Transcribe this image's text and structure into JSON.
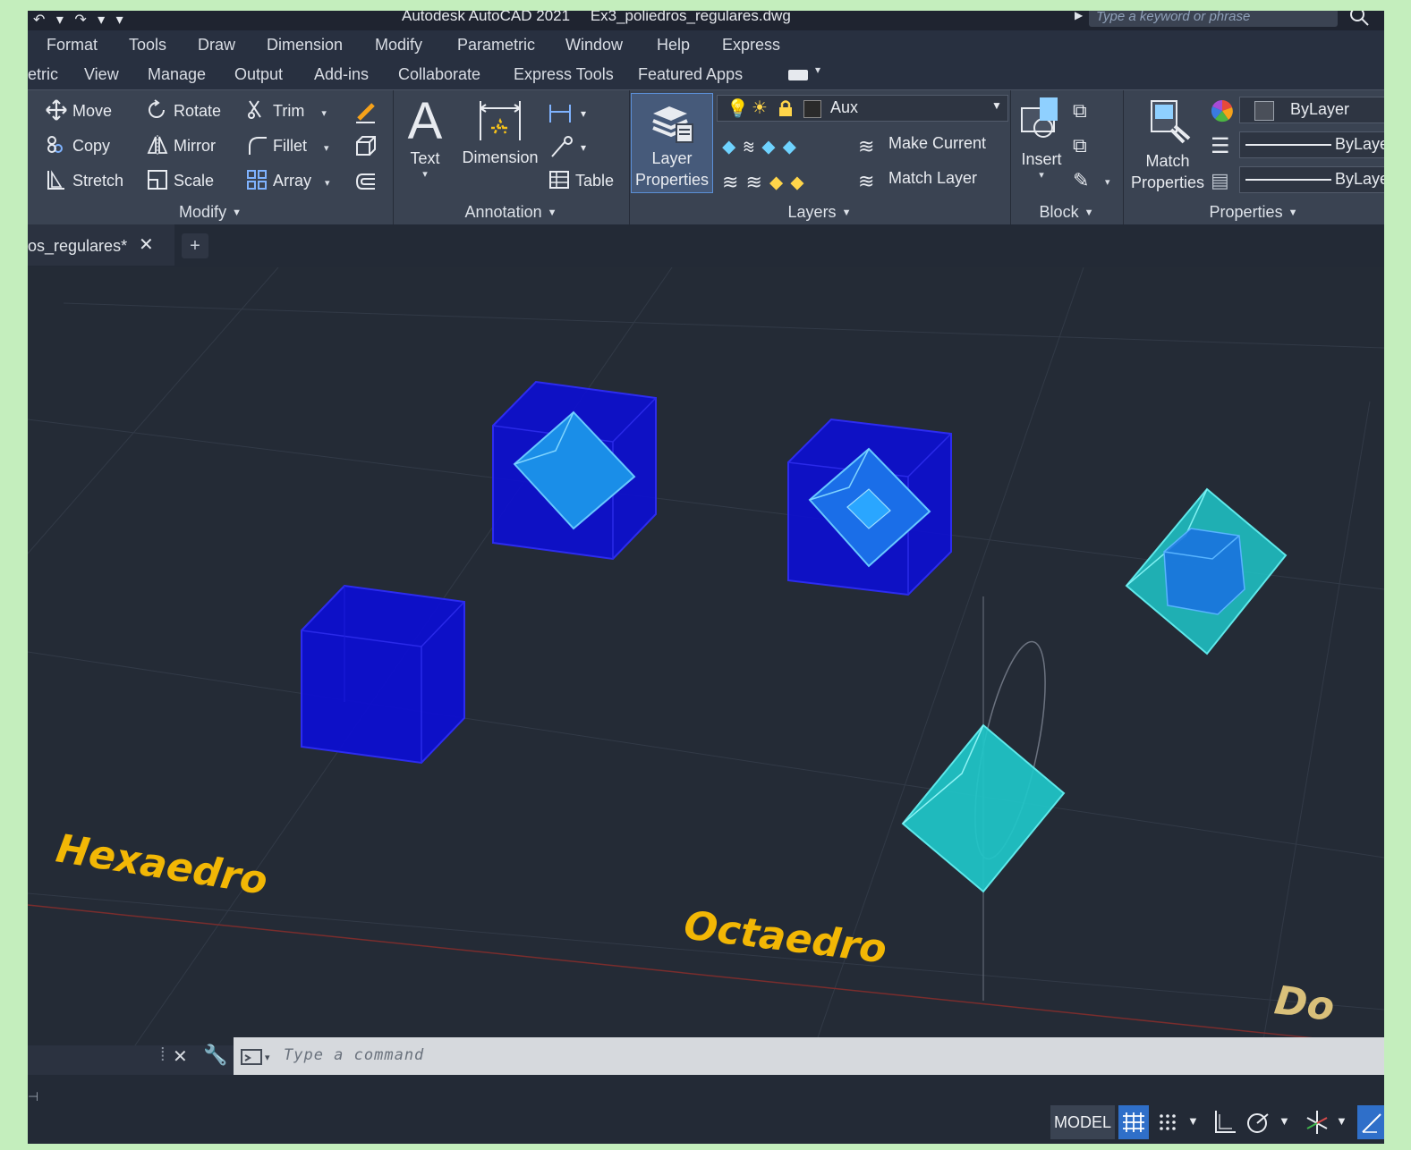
{
  "titlebar": {
    "app_title": "Autodesk AutoCAD 2021",
    "file_title": "Ex3_poliedros_regulares.dwg",
    "search_placeholder": "Type a keyword or phrase"
  },
  "menu": [
    "Format",
    "Tools",
    "Draw",
    "Dimension",
    "Modify",
    "Parametric",
    "Window",
    "Help",
    "Express"
  ],
  "ribbon_tabs": [
    "etric",
    "View",
    "Manage",
    "Output",
    "Add-ins",
    "Collaborate",
    "Express Tools",
    "Featured Apps"
  ],
  "modify_panel": {
    "label": "Modify",
    "move": "Move",
    "rotate": "Rotate",
    "trim": "Trim",
    "copy": "Copy",
    "mirror": "Mirror",
    "fillet": "Fillet",
    "stretch": "Stretch",
    "scale": "Scale",
    "array": "Array"
  },
  "annotation_panel": {
    "label": "Annotation",
    "text": "Text",
    "dimension": "Dimension",
    "table": "Table"
  },
  "layers_panel": {
    "label": "Layers",
    "layer_properties_line1": "Layer",
    "layer_properties_line2": "Properties",
    "current_layer": "Aux",
    "make_current": "Make Current",
    "match_layer": "Match Layer"
  },
  "block_panel": {
    "label": "Block",
    "insert": "Insert"
  },
  "properties_panel": {
    "label": "Properties",
    "match_line1": "Match",
    "match_line2": "Properties",
    "color": "ByLayer",
    "linetype": "ByLaye",
    "lineweight": "ByLaye"
  },
  "file_tab": {
    "name": "os_regulares*",
    "close": "✕",
    "new": "+"
  },
  "drawing": {
    "labels": [
      "Hexaedro",
      "Octaedro",
      "Do"
    ],
    "label_color": "#f2b705",
    "cube_color": "#0d0fd0",
    "octa_color": "#1fc7c9"
  },
  "command_line": {
    "placeholder": "Type a command"
  },
  "statusbar": {
    "model": "MODEL"
  }
}
